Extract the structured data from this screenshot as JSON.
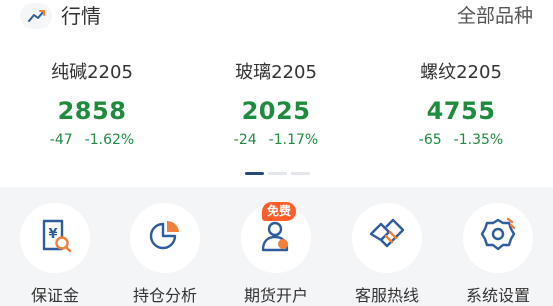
{
  "header": {
    "title": "行情",
    "all_products": "全部品种",
    "logo_icon": "trend-line-icon"
  },
  "quotes": [
    {
      "name": "纯碱2205",
      "price": "2858",
      "change": "-47",
      "change_pct": "-1.62%"
    },
    {
      "name": "玻璃2205",
      "price": "2025",
      "change": "-24",
      "change_pct": "-1.17%"
    },
    {
      "name": "螺纹2205",
      "price": "4755",
      "change": "-65",
      "change_pct": "-1.35%"
    }
  ],
  "pager": {
    "pages": 3,
    "active": 0
  },
  "services": [
    {
      "label": "保证金",
      "icon": "margin-calculator-icon"
    },
    {
      "label": "持仓分析",
      "icon": "pie-chart-icon"
    },
    {
      "label": "期货开户",
      "icon": "open-account-icon",
      "badge": "免费"
    },
    {
      "label": "客服热线",
      "icon": "handshake-icon"
    },
    {
      "label": "系统设置",
      "icon": "gear-icon"
    }
  ],
  "colors": {
    "down": "#1f8b3e",
    "icon_blue": "#2f5c9c",
    "icon_orange": "#f57f3a",
    "badge": "#ff5e2b",
    "pager_active": "#284a78"
  }
}
